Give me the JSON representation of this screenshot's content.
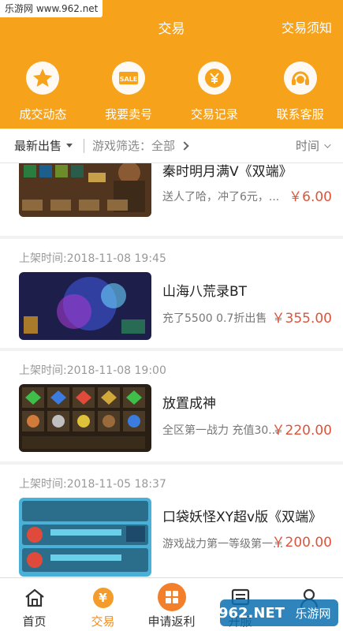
{
  "watermark": {
    "top_text": "乐游网 www.962.net",
    "bottom_logo": "962.NET",
    "bottom_text": "乐游网"
  },
  "header": {
    "title": "交易",
    "notice_link": "交易须知",
    "tiles": [
      {
        "label": "成交动态",
        "icon": "star-badge-icon"
      },
      {
        "label": "我要卖号",
        "icon": "sale-tag-icon",
        "icon_text": "SALE"
      },
      {
        "label": "交易记录",
        "icon": "yen-record-icon"
      },
      {
        "label": "联系客服",
        "icon": "headset-icon"
      }
    ],
    "color": "#f7a21b"
  },
  "filter": {
    "sort_label": "最新出售",
    "game_filter": "游戏筛选：全部",
    "time_label": "时间"
  },
  "listings": [
    {
      "time": "",
      "name": "秦时明月满V《双端》",
      "desc": "送人了哈，冲了6元，...",
      "price": "￥6.00"
    },
    {
      "time": "上架时间:2018-11-08 19:45",
      "name": "山海八荒录BT",
      "desc": "充了5500  0.7折出售",
      "price": "￥355.00"
    },
    {
      "time": "上架时间:2018-11-08 19:00",
      "name": "放置成神",
      "desc": "全区第一战力  充值30...",
      "price": "￥220.00"
    },
    {
      "time": "上架时间:2018-11-05 18:37",
      "name": "口袋妖怪XY超v版《双端》",
      "desc": "游戏战力第一等级第一...",
      "price": "￥200.00"
    }
  ],
  "bottom_nav": [
    {
      "label": "首页",
      "icon": "home-icon"
    },
    {
      "label": "交易",
      "icon": "yen-icon",
      "icon_text": "¥",
      "active": true
    },
    {
      "label": "申请返利",
      "icon": "apps-grid-icon"
    },
    {
      "label": "开服",
      "icon": "server-icon"
    },
    {
      "label": "",
      "icon": "user-icon"
    }
  ],
  "accent_price_color": "#e0533a",
  "active_tab_color": "#f08c1a"
}
